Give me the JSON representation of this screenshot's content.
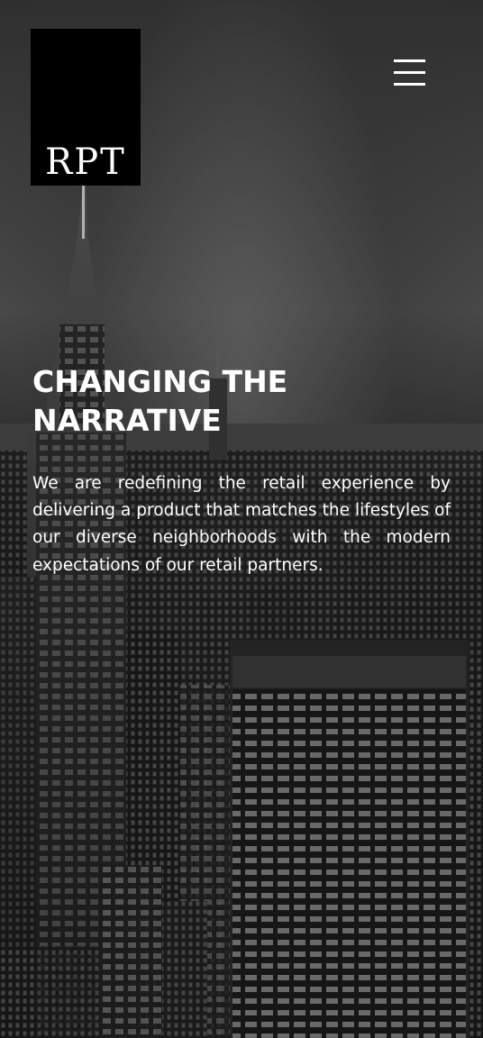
{
  "brand": {
    "logo_text": "RPT"
  },
  "nav": {
    "menu_icon": "hamburger-menu-icon"
  },
  "hero": {
    "headline": "CHANGING THE NARRATIVE",
    "body": "We are redefining the retail experience by delivering a product that matches the lifestyles of our diverse neighborhoods with the modern expectations of our retail partners."
  },
  "colors": {
    "text": "#ffffff",
    "logo_background": "#000000"
  }
}
